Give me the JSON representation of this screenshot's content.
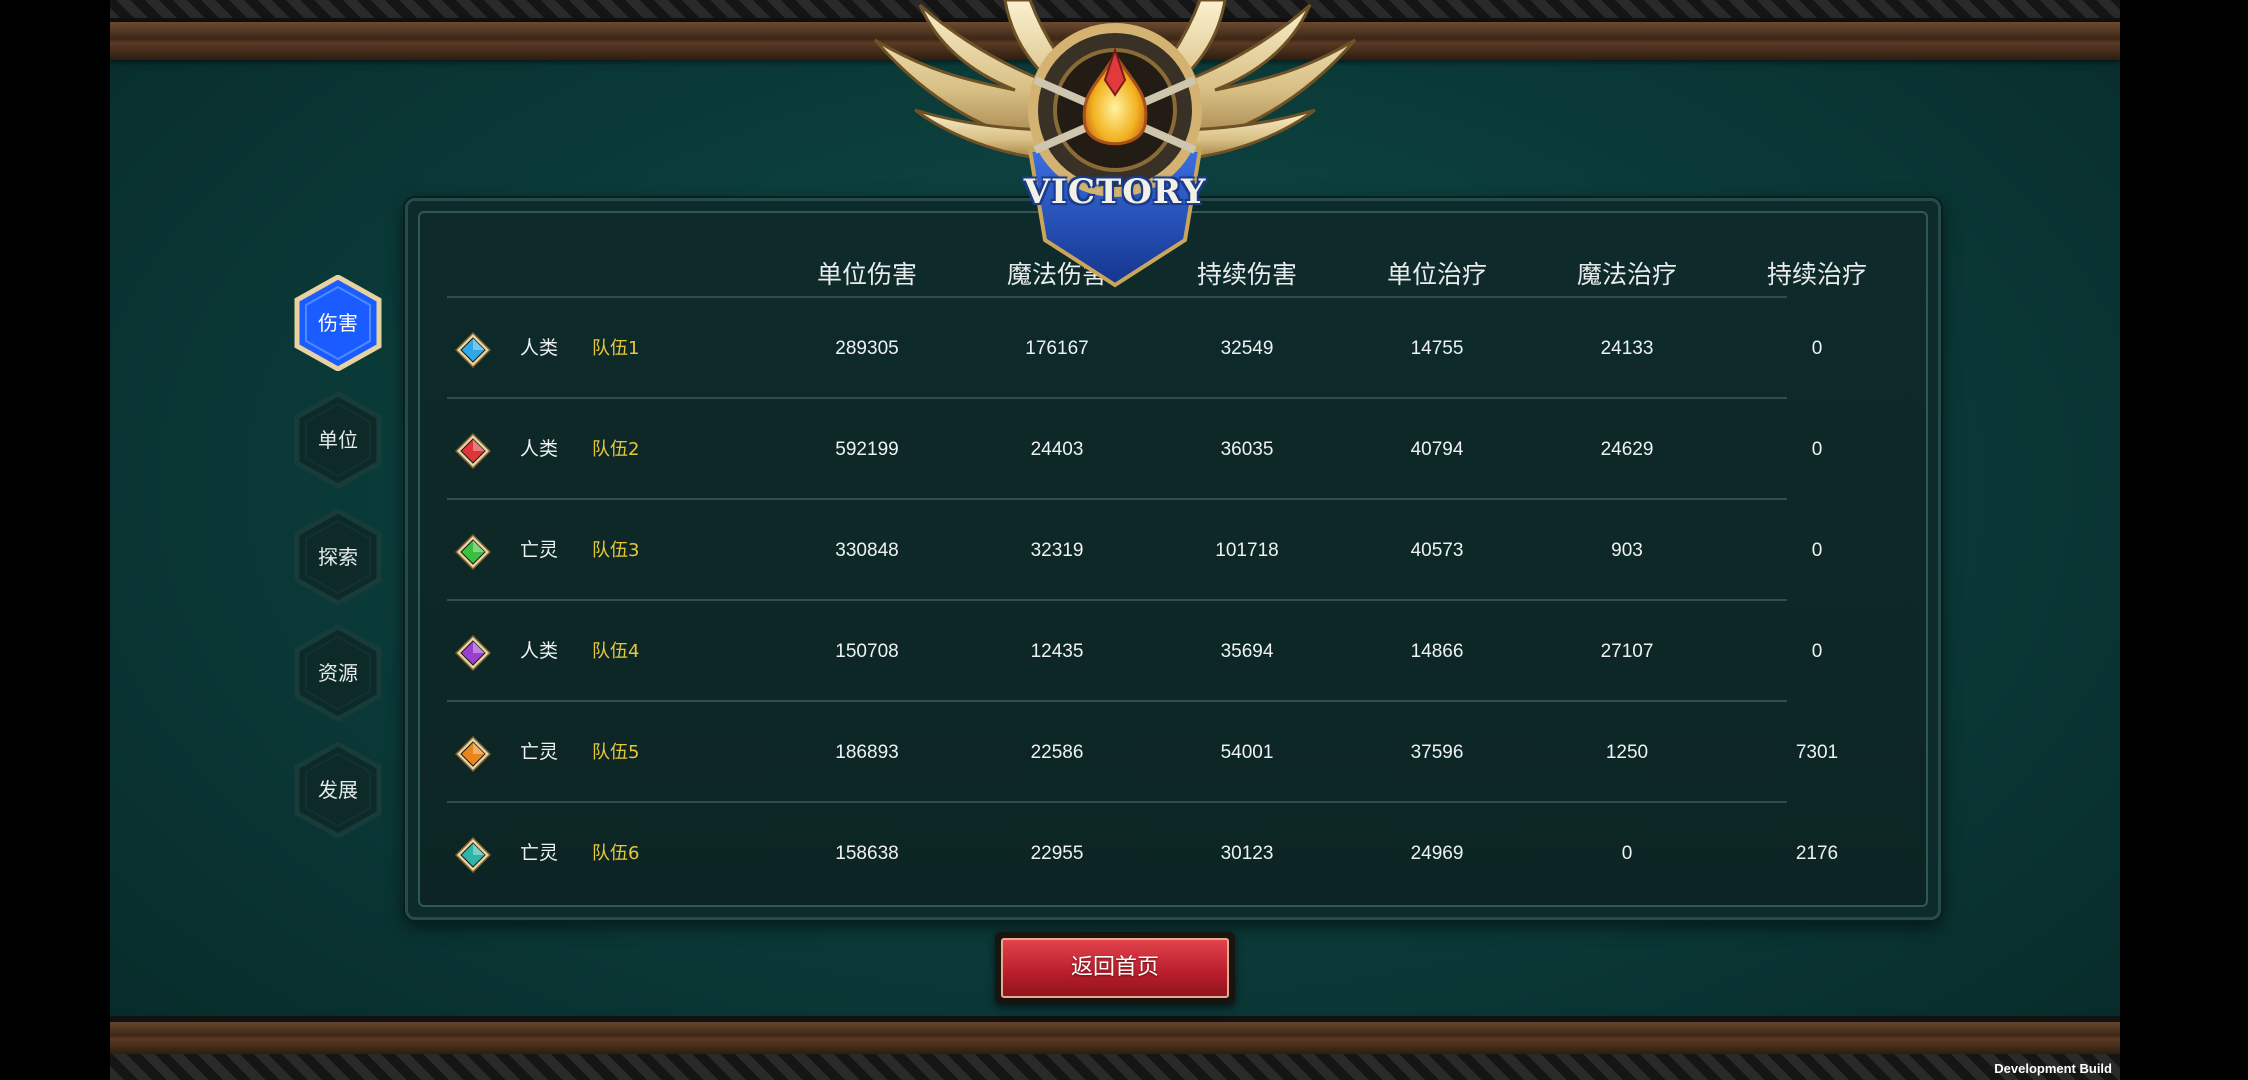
{
  "banner": {
    "title": "VICTORY"
  },
  "tabs": [
    {
      "label": "伤害",
      "active": true
    },
    {
      "label": "单位",
      "active": false
    },
    {
      "label": "探索",
      "active": false
    },
    {
      "label": "资源",
      "active": false
    },
    {
      "label": "发展",
      "active": false
    }
  ],
  "table": {
    "columns": [
      "单位伤害",
      "魔法伤害",
      "持续伤害",
      "单位治疗",
      "魔法治疗",
      "持续治疗"
    ],
    "rows": [
      {
        "gem_icon": "blue-diamond-icon",
        "gem_color": "#2fa8e6",
        "race": "人类",
        "team": "队伍1",
        "values": [
          "289305",
          "176167",
          "32549",
          "14755",
          "24133",
          "0"
        ]
      },
      {
        "gem_icon": "red-diamond-icon",
        "gem_color": "#e0343b",
        "race": "人类",
        "team": "队伍2",
        "values": [
          "592199",
          "24403",
          "36035",
          "40794",
          "24629",
          "0"
        ]
      },
      {
        "gem_icon": "green-diamond-icon",
        "gem_color": "#3cbf3c",
        "race": "亡灵",
        "team": "队伍3",
        "values": [
          "330848",
          "32319",
          "101718",
          "40573",
          "903",
          "0"
        ]
      },
      {
        "gem_icon": "purple-diamond-icon",
        "gem_color": "#9b3fd1",
        "race": "人类",
        "team": "队伍4",
        "values": [
          "150708",
          "12435",
          "35694",
          "14866",
          "27107",
          "0"
        ]
      },
      {
        "gem_icon": "orange-diamond-icon",
        "gem_color": "#e6861c",
        "race": "亡灵",
        "team": "队伍5",
        "values": [
          "186893",
          "22586",
          "54001",
          "37596",
          "1250",
          "7301"
        ]
      },
      {
        "gem_icon": "teal-diamond-icon",
        "gem_color": "#2fb4a8",
        "race": "亡灵",
        "team": "队伍6",
        "values": [
          "158638",
          "22955",
          "30123",
          "24969",
          "0",
          "2176"
        ]
      }
    ]
  },
  "return_button": {
    "label": "返回首页"
  },
  "footer": {
    "build_label": "Development Build"
  },
  "colors": {
    "team_label": "#e7c83a",
    "active_tab": "#1a5cff",
    "return_button": "#c42230"
  }
}
